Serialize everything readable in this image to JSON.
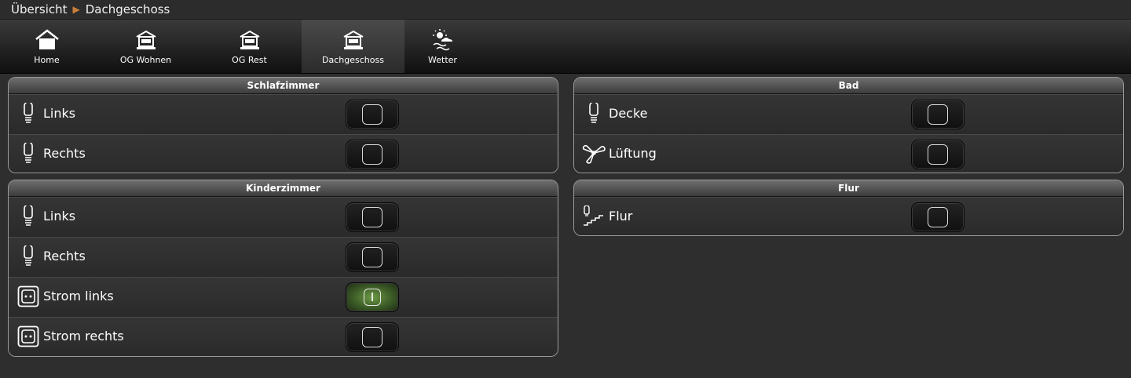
{
  "breadcrumb": {
    "root": "Übersicht",
    "current": "Dachgeschoss"
  },
  "nav": [
    {
      "label": "Home",
      "icon": "house-icon",
      "active": false
    },
    {
      "label": "OG Wohnen",
      "icon": "floor-house-icon",
      "active": false
    },
    {
      "label": "OG Rest",
      "icon": "floor-house-icon",
      "active": false
    },
    {
      "label": "Dachgeschoss",
      "icon": "floor-house-icon",
      "active": true
    },
    {
      "label": "Wetter",
      "icon": "weather-icon",
      "active": false
    }
  ],
  "panels": {
    "schlafzimmer": {
      "title": "Schlafzimmer",
      "rows": [
        {
          "label": "Links",
          "icon": "bulb-icon",
          "on": false
        },
        {
          "label": "Rechts",
          "icon": "bulb-icon",
          "on": false
        }
      ]
    },
    "kinderzimmer": {
      "title": "Kinderzimmer",
      "rows": [
        {
          "label": "Links",
          "icon": "bulb-icon",
          "on": false
        },
        {
          "label": "Rechts",
          "icon": "bulb-icon",
          "on": false
        },
        {
          "label": "Strom links",
          "icon": "socket-icon",
          "on": true
        },
        {
          "label": "Strom rechts",
          "icon": "socket-icon",
          "on": false
        }
      ]
    },
    "bad": {
      "title": "Bad",
      "rows": [
        {
          "label": "Decke",
          "icon": "bulb-icon",
          "on": false
        },
        {
          "label": "Lüftung",
          "icon": "fan-icon",
          "on": false
        }
      ]
    },
    "flur": {
      "title": "Flur",
      "rows": [
        {
          "label": "Flur",
          "icon": "stair-light-icon",
          "on": false
        }
      ]
    }
  },
  "colors": {
    "on_accent": "#6c9a45",
    "breadcrumb_sep": "#c97e3a"
  }
}
